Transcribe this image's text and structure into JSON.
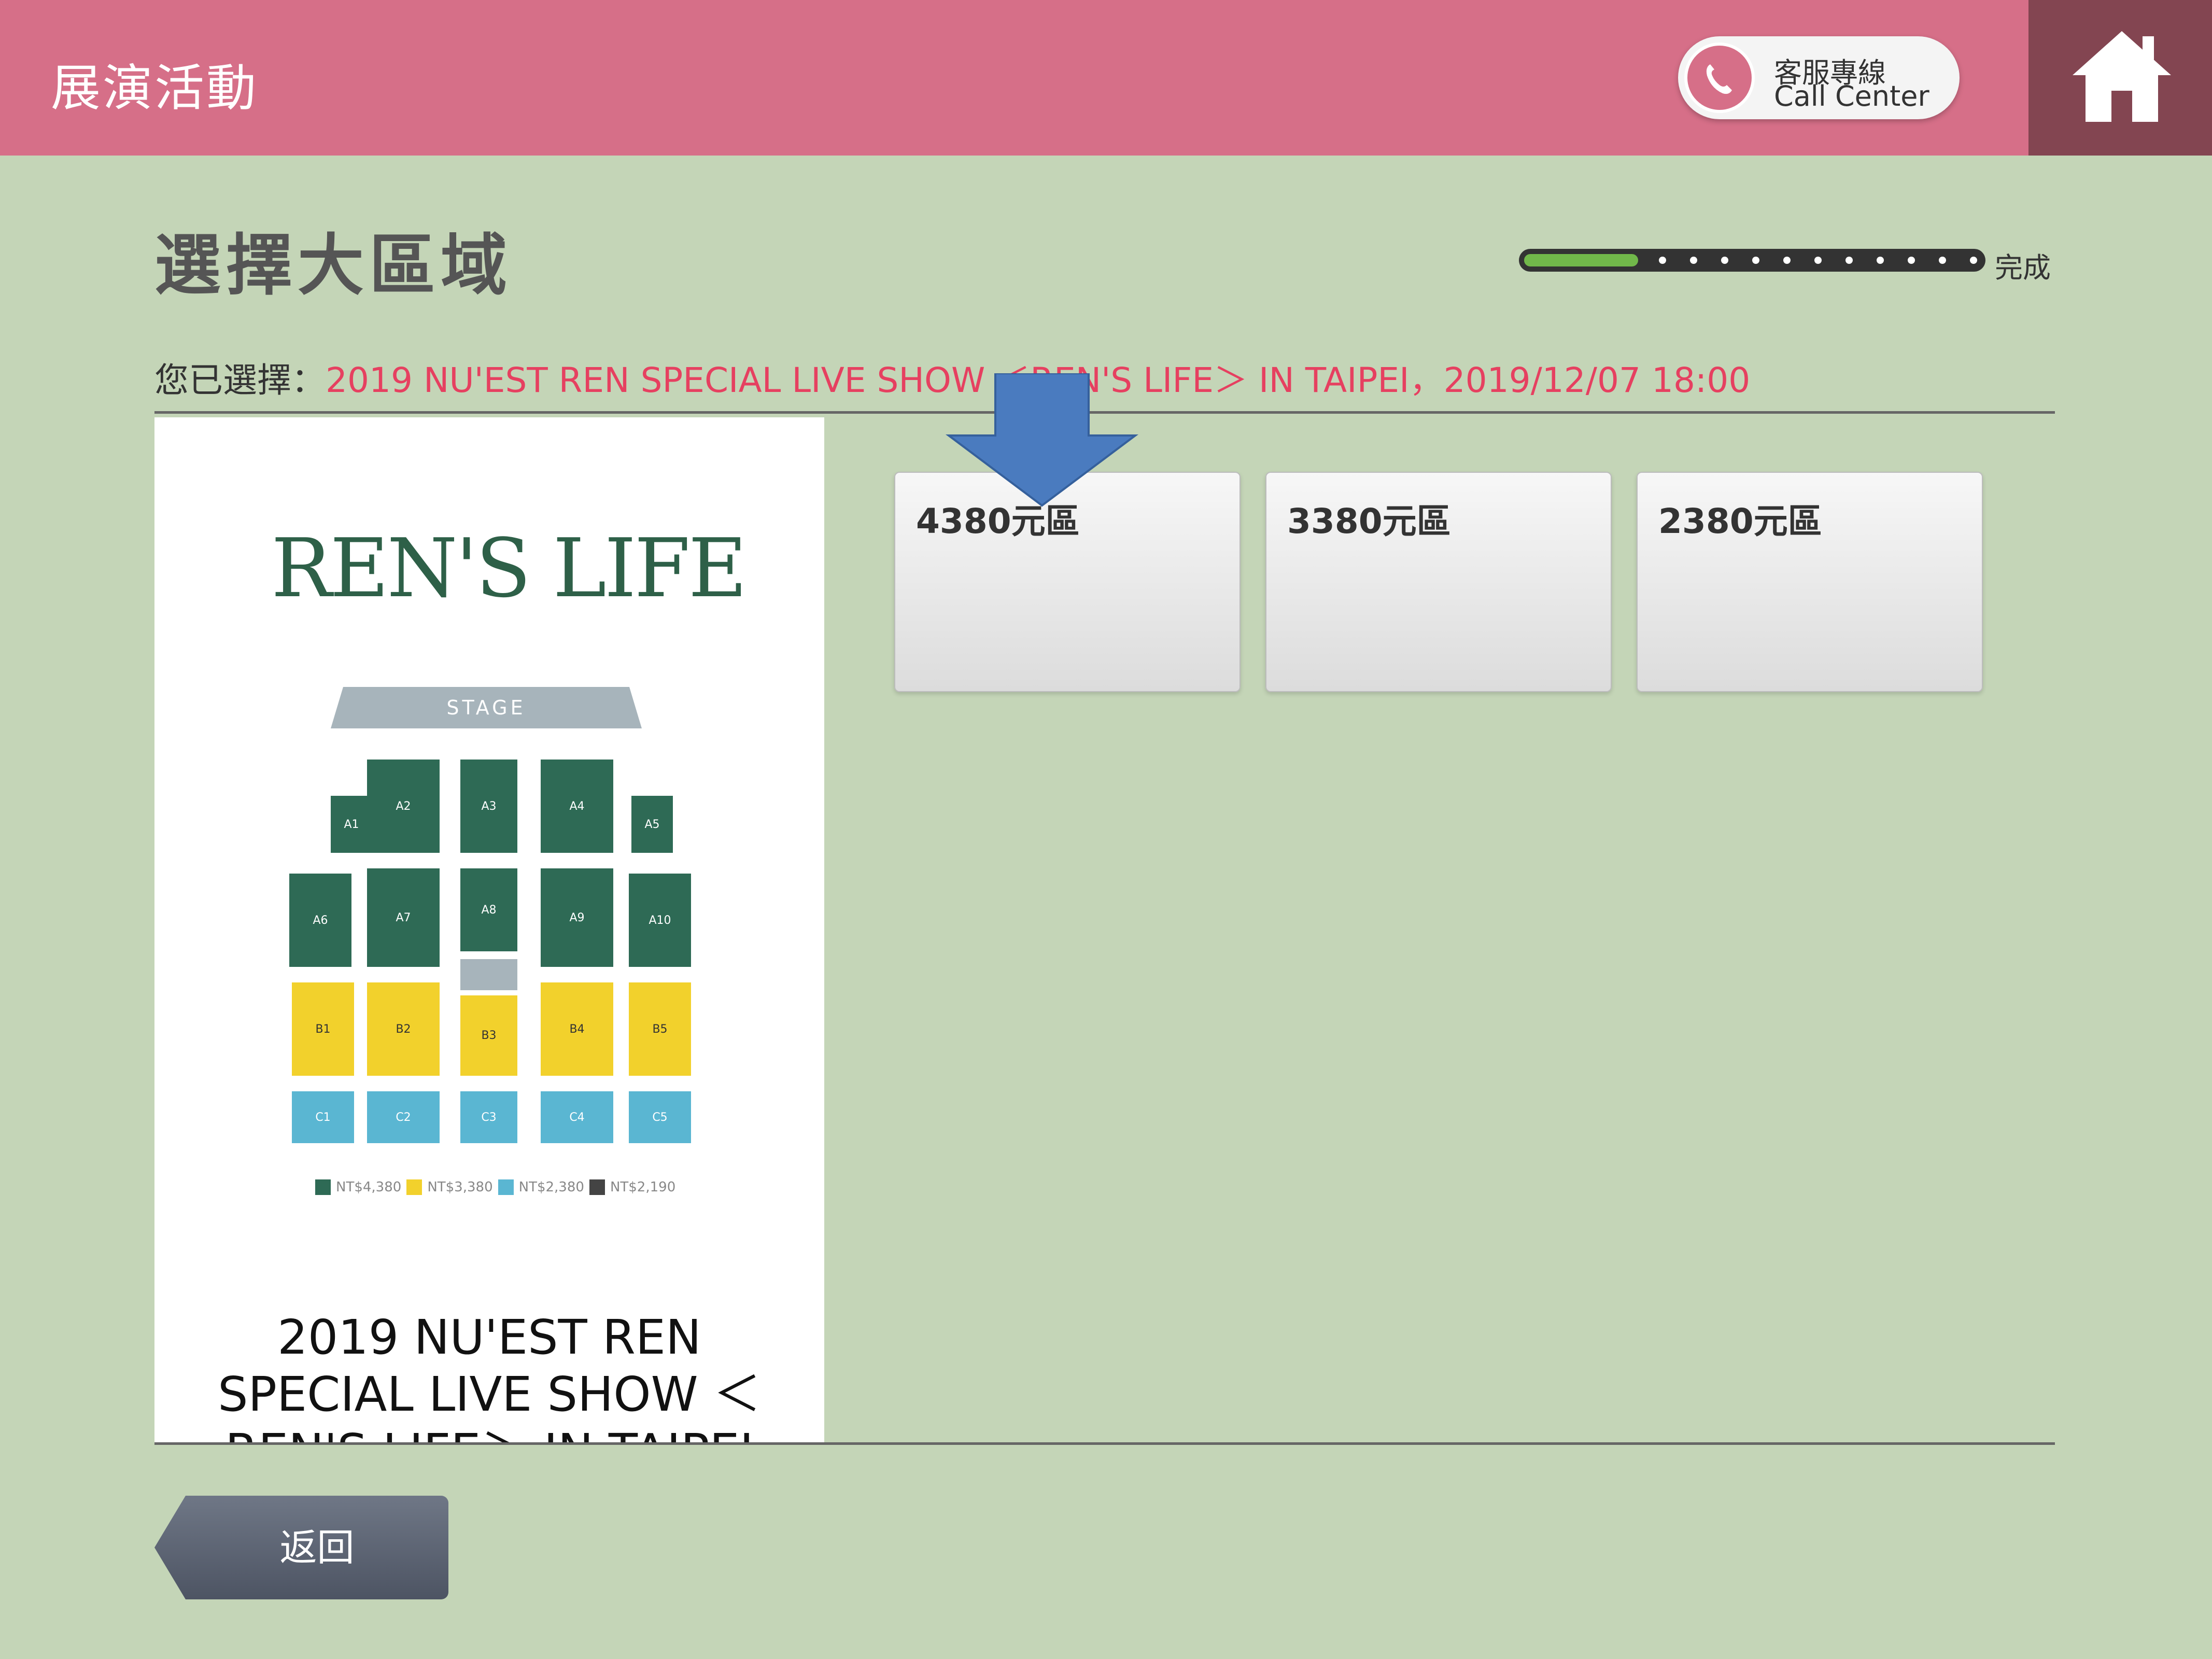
{
  "header": {
    "title": "展演活動",
    "call_center_zh": "客服專線",
    "call_center_en": "Call Center",
    "home_icon": "home-icon",
    "background_color": "#d66f88",
    "home_bg_color": "#834551"
  },
  "page": {
    "title": "選擇大區域",
    "progress_end_label": "完成",
    "progress_fraction": 0.25
  },
  "selection": {
    "prefix": "您已選擇：",
    "value": "2019 NU'EST REN SPECIAL LIVE SHOW ＜REN'S LIFE＞ IN TAIPEI，2019/12/07 18:00"
  },
  "poster": {
    "title": "REN'S LIFE",
    "stage_label": "STAGE",
    "sections": {
      "a": [
        "A1",
        "A2",
        "A3",
        "A4",
        "A5",
        "A6",
        "A7",
        "A8",
        "A9",
        "A10"
      ],
      "b": [
        "B1",
        "B2",
        "B3",
        "B4",
        "B5"
      ],
      "c": [
        "C1",
        "C2",
        "C3",
        "C4",
        "C5"
      ]
    },
    "legend": [
      "NT$4,380",
      "NT$3,380",
      "NT$2,380",
      "NT$2,190"
    ],
    "caption_line1": "2019 NU'EST REN",
    "caption_line2": "SPECIAL LIVE SHOW ＜",
    "caption_line3": "REN'S LIFE＞ IN TAIPEI"
  },
  "zones": [
    {
      "label": "4380元區"
    },
    {
      "label": "3380元區"
    },
    {
      "label": "2380元區"
    }
  ],
  "annotation": {
    "arrow_icon": "arrow-down-icon",
    "color": "#4a7bbf"
  },
  "footer": {
    "back_label": "返回"
  }
}
